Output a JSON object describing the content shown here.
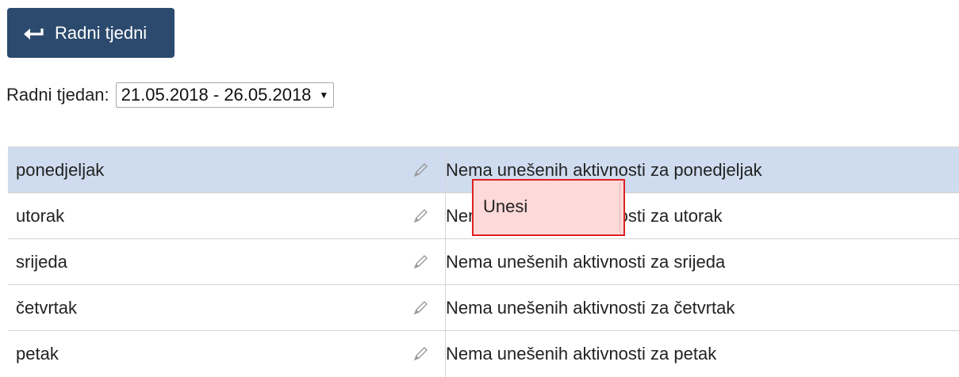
{
  "back_button": {
    "label": "Radni tjedni",
    "icon": "return-arrow-icon"
  },
  "week_selector": {
    "label": "Radni tjedan:",
    "selected": "21.05.2018 - 26.05.2018",
    "caret": "▼"
  },
  "days": [
    {
      "day": "ponedjeljak",
      "activity": "Nema unešenih aktivnosti za ponedjeljak",
      "highlighted": true
    },
    {
      "day": "utorak",
      "activity": "Nema unešenih aktivnosti za utorak",
      "highlighted": false
    },
    {
      "day": "srijeda",
      "activity": "Nema unešenih aktivnosti za srijeda",
      "highlighted": false
    },
    {
      "day": "četvrtak",
      "activity": "Nema unešenih aktivnosti za četvrtak",
      "highlighted": false
    },
    {
      "day": "petak",
      "activity": "Nema unešenih aktivnosti za petak",
      "highlighted": false
    }
  ],
  "popup": {
    "label": "Unesi"
  },
  "colors": {
    "button_bg": "#2c4a6e",
    "row_highlight": "#cfdcef",
    "popup_bg": "#fdd9d9",
    "popup_border": "#e02020"
  }
}
